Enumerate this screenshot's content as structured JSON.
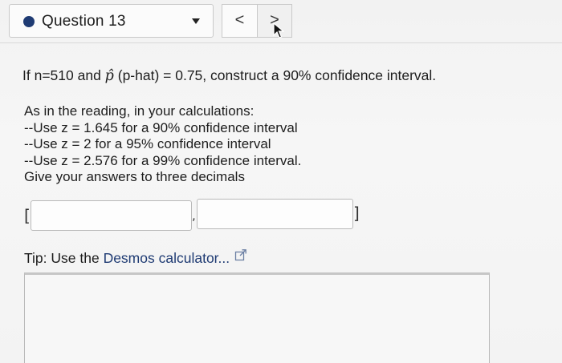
{
  "header": {
    "question_label": "Question 13",
    "prev_label": "<",
    "next_label": ">",
    "status_color": "#1f3b73"
  },
  "question": {
    "prompt_prefix": "If n=510 and ",
    "p_hat_symbol": "p̂",
    "prompt_suffix": " (p-hat) = 0.75, construct a 90% confidence interval."
  },
  "instructions": [
    "As in the reading, in your calculations:",
    "--Use z = 1.645 for a 90% confidence interval",
    "--Use z = 2 for a 95% confidence interval",
    "--Use z = 2.576 for a 99% confidence interval.",
    "Give your answers to three decimals"
  ],
  "answer": {
    "open_bracket": "[",
    "separator": ",",
    "close_bracket": "]",
    "lower_value": "",
    "upper_value": ""
  },
  "tip": {
    "prefix": "Tip: Use the ",
    "link_label": "Desmos calculator...",
    "link_color": "#1f3b73"
  },
  "icons": {
    "dropdown": "chevron-down-icon",
    "external_link": "external-link-icon",
    "cursor": "mouse-pointer-icon"
  }
}
